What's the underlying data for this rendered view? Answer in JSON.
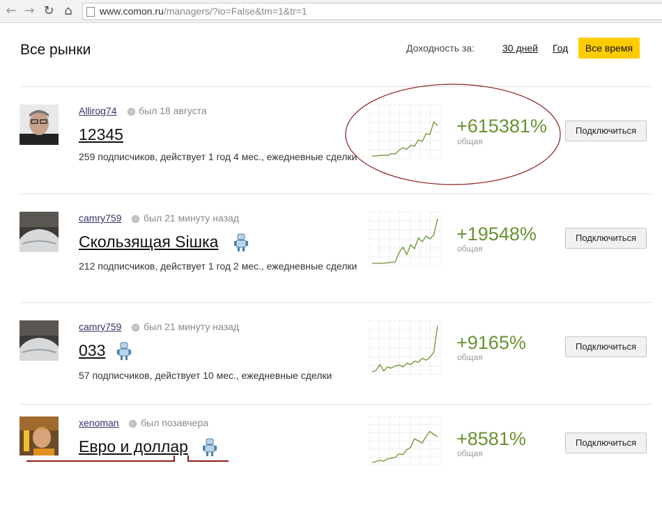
{
  "browser": {
    "url_host": "www.comon.ru",
    "url_path": "/managers/?io=False&tm=1&tr=1"
  },
  "header": {
    "title": "Все рынки",
    "period_label": "Доходность за:",
    "periods": [
      "30 дней",
      "Год",
      "Все время"
    ],
    "active_period": "Все время"
  },
  "managers": [
    {
      "username": "Allirog74",
      "status": "был 18 августа",
      "strategy": "12345",
      "robot": false,
      "description": "259 подписчиков, действует 1 год 4 мес., ежедневные сделки",
      "return": "+615381%",
      "return_label": "общая",
      "button": "Подключиться",
      "chart": [
        0,
        0,
        0.01,
        0.02,
        0.01,
        0.05,
        0.04,
        0.12,
        0.17,
        0.14,
        0.22,
        0.2,
        0.33,
        0.3,
        0.46,
        0.44,
        0.7,
        0.62
      ]
    },
    {
      "username": "camry759",
      "status": "был 21 минуту назад",
      "strategy": "Скользящая Siшка",
      "robot": true,
      "description": "212 подписчиков, действует 1 год 2 мес., ежедневные сделки",
      "return": "+19548%",
      "return_label": "общая",
      "button": "Подключиться",
      "chart": [
        0,
        0,
        0,
        0,
        0.01,
        0.02,
        0.03,
        0.22,
        0.33,
        0.18,
        0.38,
        0.3,
        0.52,
        0.44,
        0.56,
        0.5,
        0.58,
        0.92
      ]
    },
    {
      "username": "camry759",
      "status": "был 21 минуту назад",
      "strategy": "033",
      "robot": true,
      "description": "57 подписчиков, действует 10 мес., ежедневные сделки",
      "return": "+9165%",
      "return_label": "общая",
      "button": "Подключиться",
      "chart": [
        0,
        0.03,
        0.15,
        0.02,
        0.1,
        0.08,
        0.12,
        0.14,
        0.1,
        0.18,
        0.15,
        0.22,
        0.2,
        0.28,
        0.24,
        0.3,
        0.4,
        0.95
      ]
    },
    {
      "username": "xenoman",
      "status": "был позавчера",
      "strategy": "Евро и доллар",
      "robot": true,
      "description": "",
      "return": "+8581%",
      "return_label": "общая",
      "button": "Подключиться",
      "chart": [
        0,
        0.02,
        0.05,
        0.03,
        0.08,
        0.1,
        0.12,
        0.2,
        0.18,
        0.3,
        0.35,
        0.55,
        0.5,
        0.45,
        0.6,
        0.72,
        0.65,
        0.6
      ]
    }
  ],
  "colors": {
    "active_period_bg": "#ffcc00",
    "return_green": "#6a9132",
    "annotation_red": "#8b1a1a"
  }
}
